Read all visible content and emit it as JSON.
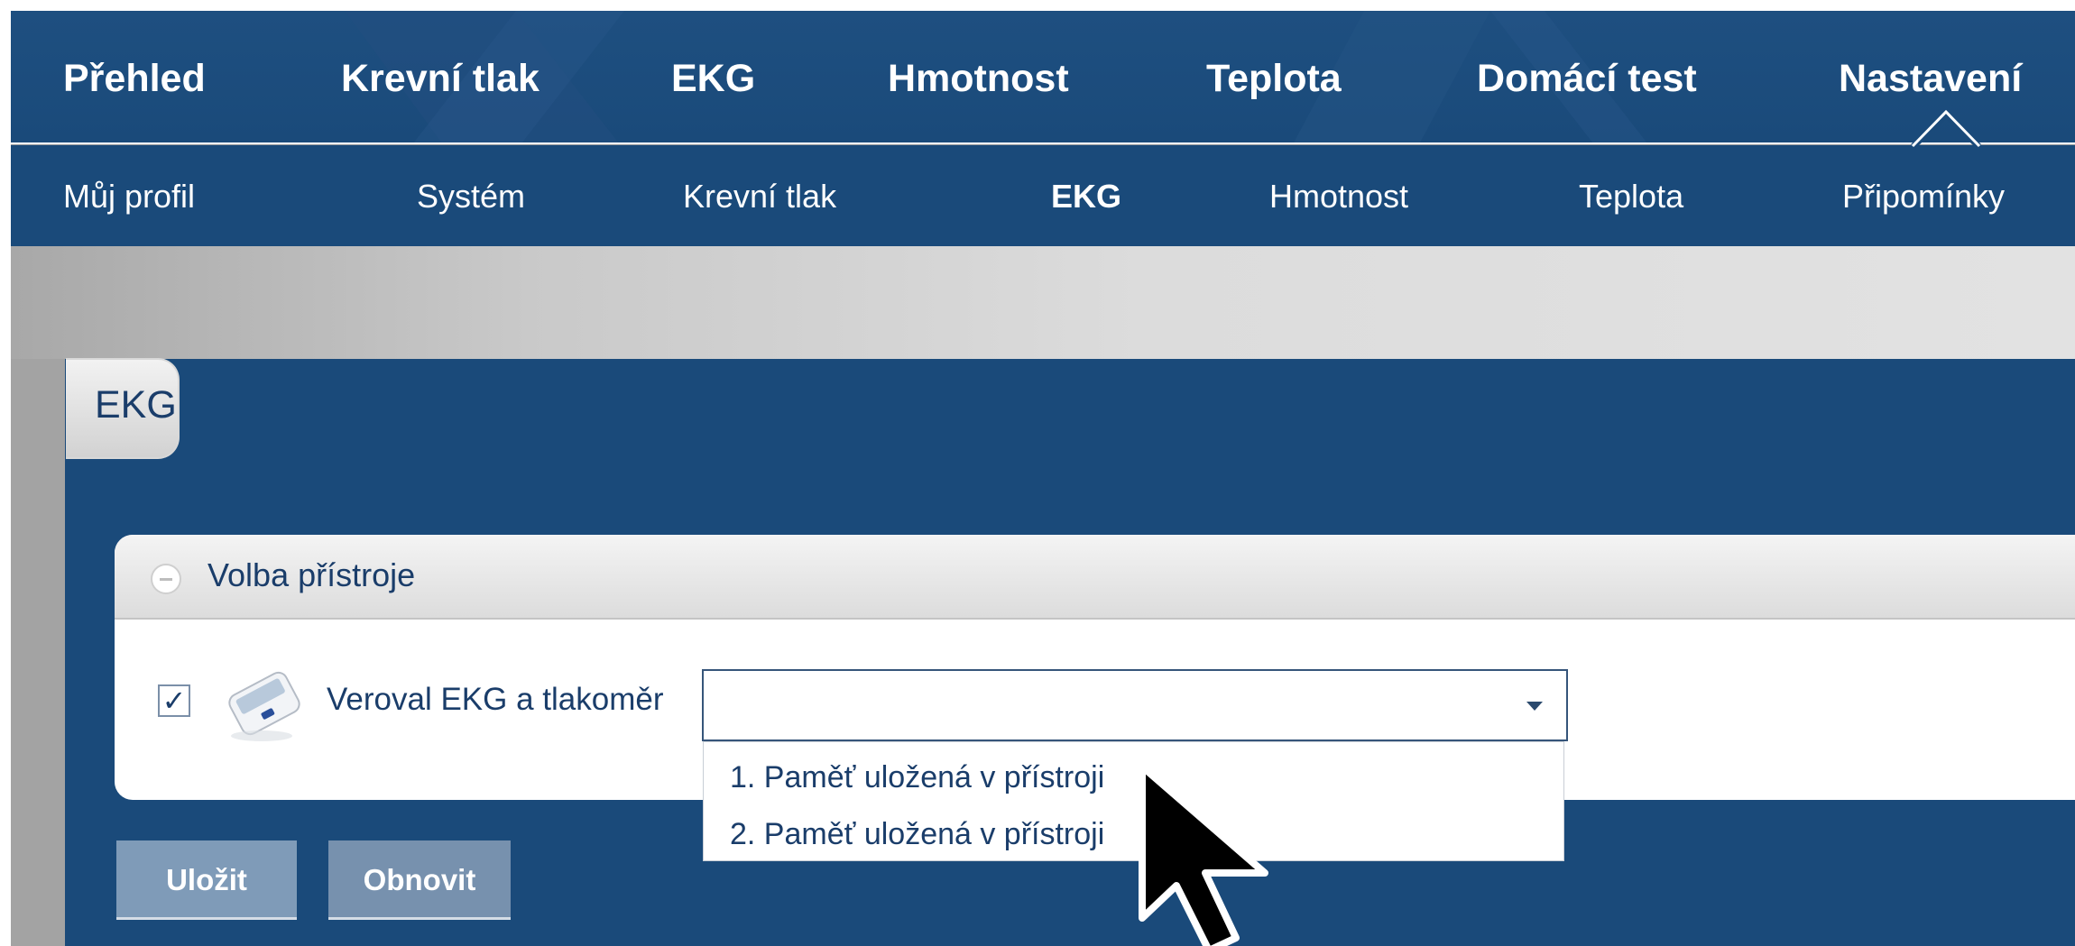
{
  "top_nav": {
    "items": [
      {
        "label": "Přehled"
      },
      {
        "label": "Krevní tlak"
      },
      {
        "label": "EKG"
      },
      {
        "label": "Hmotnost"
      },
      {
        "label": "Teplota"
      },
      {
        "label": "Domácí test"
      },
      {
        "label": "Nastavení"
      }
    ],
    "active": "Nastavení"
  },
  "sub_nav": {
    "items": [
      {
        "label": "Můj profil"
      },
      {
        "label": "Systém"
      },
      {
        "label": "Krevní tlak"
      },
      {
        "label": "EKG"
      },
      {
        "label": "Hmotnost"
      },
      {
        "label": "Teplota"
      },
      {
        "label": "Připomínky"
      }
    ],
    "active": "EKG"
  },
  "panel": {
    "tab_label": "EKG"
  },
  "device_card": {
    "title": "Volba přístroje",
    "device_label": "Veroval EKG a tlakoměr",
    "checked_glyph": "✓",
    "select_value": "",
    "options": [
      "1. Paměť uložená v přístroji",
      "2. Paměť uložená v přístroji"
    ]
  },
  "actions": {
    "save_label": "Uložit",
    "refresh_label": "Obnovit"
  },
  "colors": {
    "nav_blue": "#1a4a7a",
    "text_blue": "#1a3d6a",
    "button_blue": "#7f9bb8"
  }
}
